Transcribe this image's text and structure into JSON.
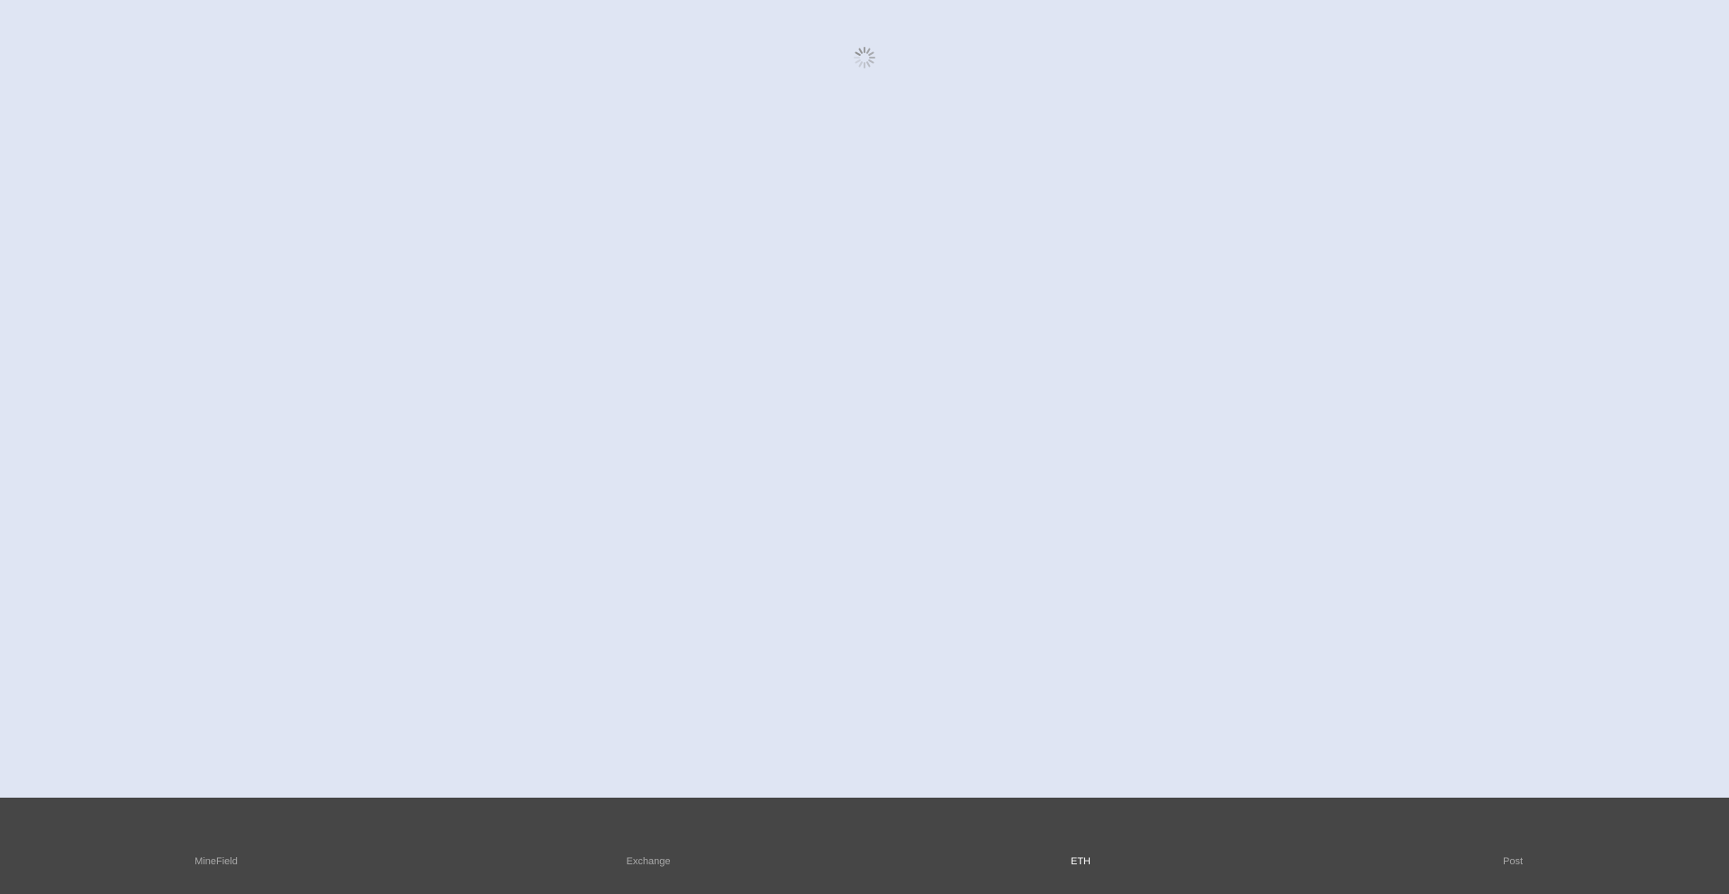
{
  "colors": {
    "page_background": "#dfe5f3",
    "tabbar_background": "#464646",
    "tab_label": "#a9a9a9",
    "tab_label_active": "#ffffff",
    "spinner": "#8a8a8a"
  },
  "loading": {
    "icon": "loading-spinner-icon"
  },
  "tabbar": {
    "active_index": 2,
    "tabs": [
      {
        "label": "MineField"
      },
      {
        "label": "Exchange"
      },
      {
        "label": "ETH"
      },
      {
        "label": "Post"
      }
    ]
  }
}
